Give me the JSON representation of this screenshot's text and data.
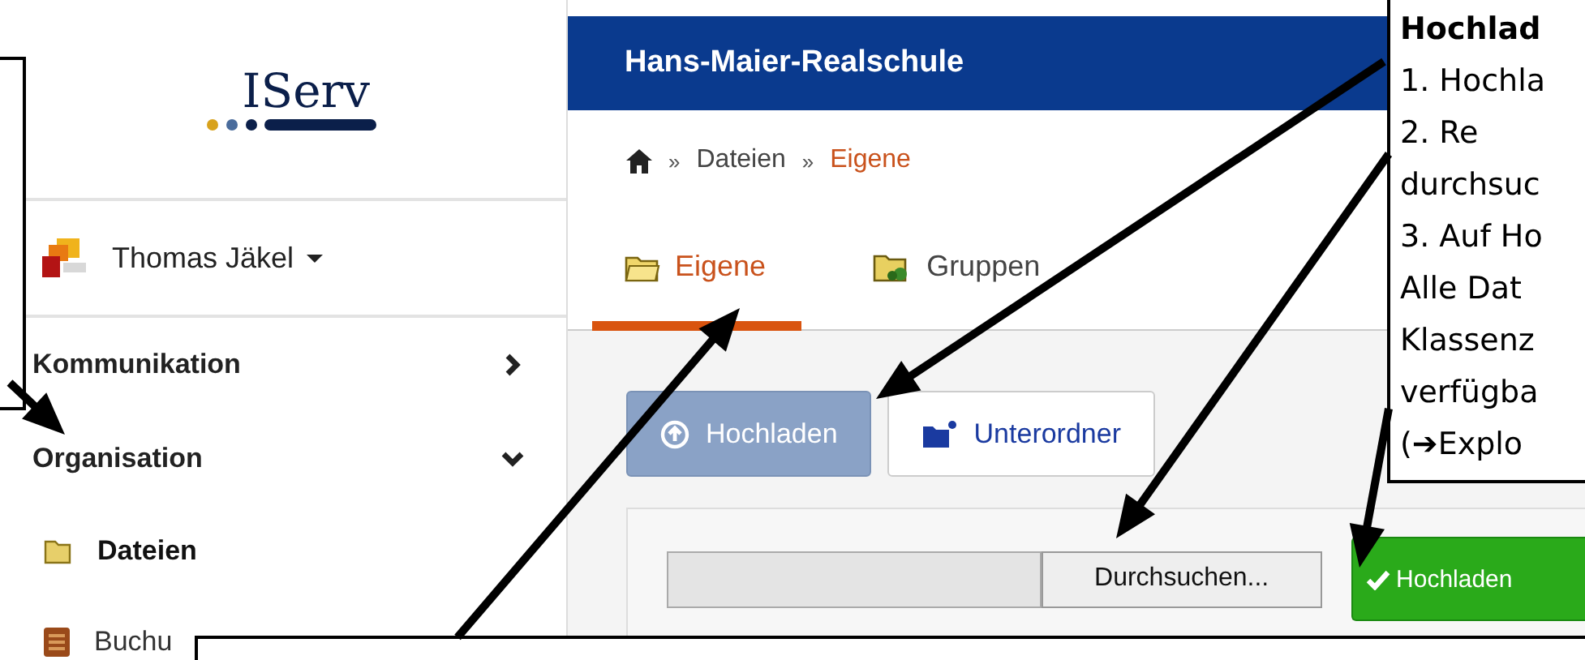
{
  "sidebar": {
    "logo": "IServ",
    "user": {
      "name": "Thomas Jäkel"
    },
    "nav": [
      {
        "label": "Kommunikation",
        "expanded": false
      },
      {
        "label": "Organisation",
        "expanded": true,
        "children": [
          {
            "label": "Dateien",
            "selected": true,
            "kind": "folder"
          },
          {
            "label": "Buchu",
            "selected": false,
            "kind": "binder"
          }
        ]
      }
    ]
  },
  "header": {
    "title": "Hans-Maier-Realschule"
  },
  "breadcrumb": {
    "separator": "»",
    "items": [
      {
        "label": "Dateien",
        "current": false
      },
      {
        "label": "Eigene",
        "current": true
      }
    ]
  },
  "tabs": [
    {
      "label": "Eigene",
      "selected": true,
      "kind": "folder"
    },
    {
      "label": "Gruppen",
      "selected": false,
      "kind": "group-folder"
    }
  ],
  "actions": [
    {
      "label": "Hochladen",
      "selected": true,
      "kind": "upload"
    },
    {
      "label": "Unterordner",
      "selected": false,
      "kind": "new-folder"
    }
  ],
  "upload": {
    "browse_button": "Durchsuchen...",
    "submit_button": "Hochladen"
  },
  "callout": {
    "lines": [
      {
        "text": "Hochlad",
        "kind": "heading"
      },
      {
        "text": "1. Hochla",
        "kind": "body"
      },
      {
        "text": "2. Re",
        "kind": "body"
      },
      {
        "text": "durchsuc",
        "kind": "body"
      },
      {
        "text": "3. Auf Ho",
        "kind": "body"
      },
      {
        "text": "Alle Dat",
        "kind": "body"
      },
      {
        "text": "Klassenz",
        "kind": "body"
      },
      {
        "text": "verfügba",
        "kind": "body"
      },
      {
        "text": "(➔Explo",
        "kind": "body"
      }
    ]
  }
}
